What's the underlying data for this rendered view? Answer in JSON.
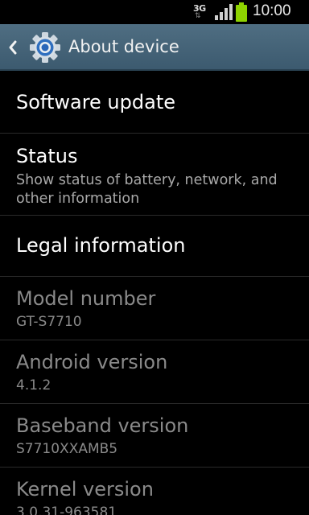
{
  "status_bar": {
    "network_type": "3G",
    "network_arrows": "⇅",
    "signal_icon": "signal-bars",
    "battery_icon": "battery-full",
    "time": "10:00",
    "accent_battery": "#8ed300"
  },
  "action_bar": {
    "title": "About device",
    "icon": "settings-gear",
    "back_icon": "chevron-left"
  },
  "items": [
    {
      "title": "Software update"
    },
    {
      "title": "Status",
      "summary": "Show status of battery, network, and other information"
    },
    {
      "title": "Legal information"
    },
    {
      "title": "Model number",
      "summary": "GT-S7710"
    },
    {
      "title": "Android version",
      "summary": "4.1.2"
    },
    {
      "title": "Baseband version",
      "summary": "S7710XXAMB5"
    },
    {
      "title": "Kernel version",
      "summary": "3.0.31-963581"
    }
  ],
  "colors": {
    "background": "#000000",
    "action_bar": "#46647a",
    "primary_text": "#ffffff",
    "secondary_text": "#a8a8a8",
    "disabled_text": "#8a8a8a",
    "divider": "#2a2a2a"
  }
}
